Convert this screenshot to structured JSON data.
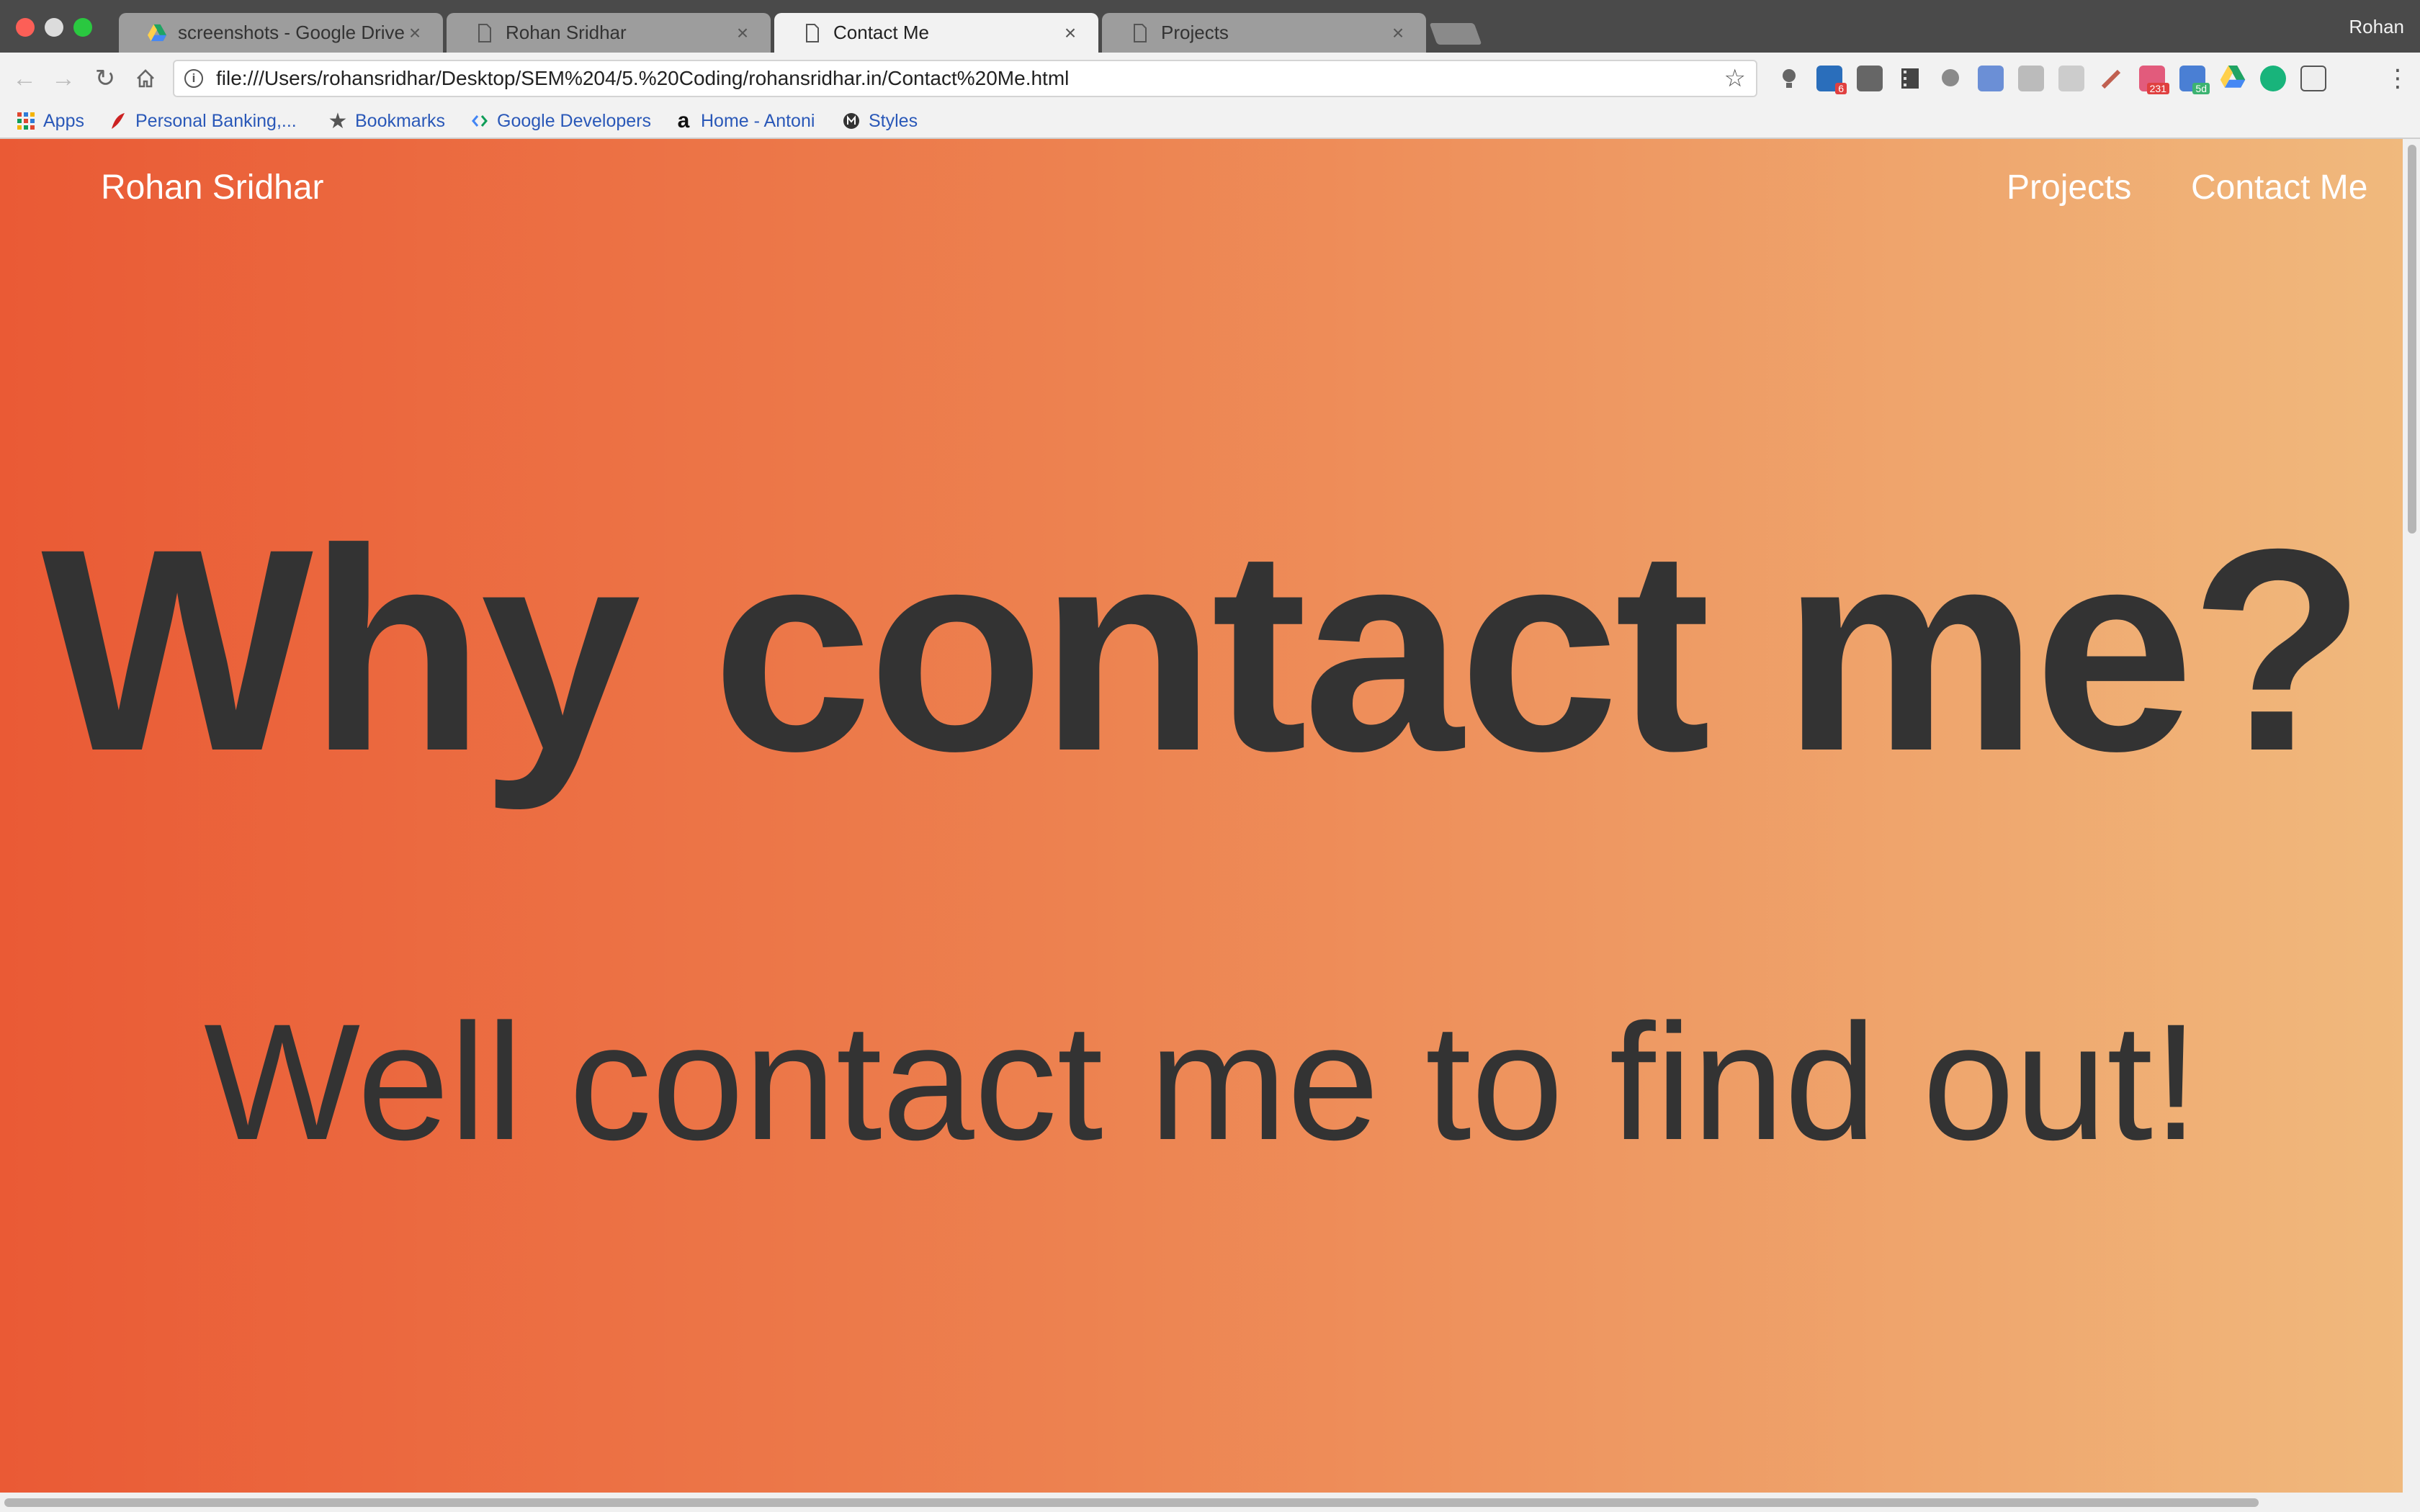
{
  "browser": {
    "tabs": [
      {
        "title": "screenshots - Google Drive",
        "icon": "google-drive-icon",
        "active": false
      },
      {
        "title": "Rohan Sridhar",
        "icon": "document-icon",
        "active": false
      },
      {
        "title": "Contact Me",
        "icon": "document-icon",
        "active": true
      },
      {
        "title": "Projects",
        "icon": "document-icon",
        "active": false
      }
    ],
    "tab_close_glyph": "×",
    "profile_name": "Rohan",
    "url": "file:///Users/rohansridhar/Desktop/SEM%204/5.%20Coding/rohansridhar.in/Contact%20Me.html",
    "info_glyph": "i",
    "extension_badges": {
      "linkedin": "6",
      "calendar": "231",
      "gmail": "5d"
    },
    "bookmarks": [
      {
        "label": "Apps",
        "icon": "apps-grid-icon"
      },
      {
        "label": "Personal Banking,...",
        "icon": "bank-icon"
      },
      {
        "label": "Bookmarks",
        "icon": "star-icon"
      },
      {
        "label": "Google Developers",
        "icon": "google-developers-icon"
      },
      {
        "label": "Home - Antoni",
        "icon": "antoni-icon"
      },
      {
        "label": "Styles",
        "icon": "styles-icon"
      }
    ]
  },
  "page": {
    "brand": "Rohan Sridhar",
    "nav": [
      {
        "label": "Projects"
      },
      {
        "label": "Contact Me"
      }
    ],
    "headline": "Why contact me?",
    "subheadline": "Well contact me to find out!"
  },
  "colors": {
    "gradient_start": "#ea5a35",
    "gradient_end": "#f0b97d",
    "heading_text": "#333333",
    "nav_text": "#ffffff"
  }
}
